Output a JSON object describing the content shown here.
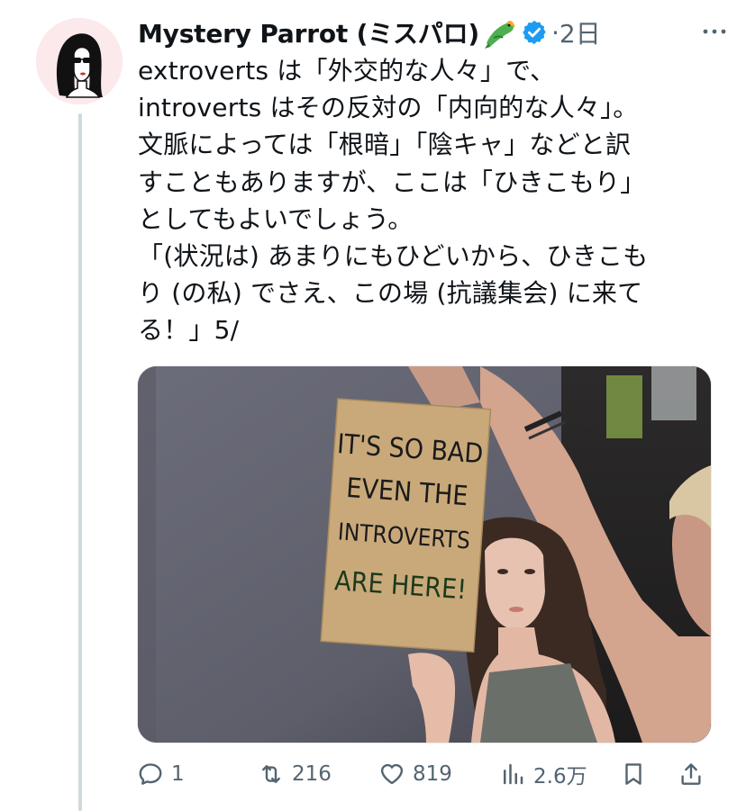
{
  "tweet": {
    "author_name": "Mystery Parrot (ミスパロ)",
    "author_emoji_icon": "parrot-emoji",
    "verified_icon": "verified-badge-icon",
    "verified_color": "#1d9bf0",
    "separator": "·",
    "time": "2日",
    "more_icon": "more-dots-icon",
    "text_lines": [
      "extroverts は「外交的な人々」で、",
      "introverts はその反対の「内向的な人々」。",
      "文脈によっては「根暗」「陰キャ」などと訳",
      "すこともありますが、ここは「ひきこもり」",
      "としてもよいでしょう。",
      "「(状況は) あまりにもひどいから、ひきこも",
      "り (の私) でさえ、この場 (抗議集会) に来て",
      "る！」5/"
    ],
    "photo": {
      "sign_lines": [
        "IT'S SO BAD",
        "EVEN THE",
        "INTROVERTS",
        "ARE HERE!"
      ]
    },
    "actions": {
      "reply_count": "1",
      "retweet_count": "216",
      "like_count": "819",
      "views_count": "2.6万"
    }
  },
  "colors": {
    "text_primary": "#0f1419",
    "text_secondary": "#536471",
    "thread_line": "#cfd9de"
  }
}
